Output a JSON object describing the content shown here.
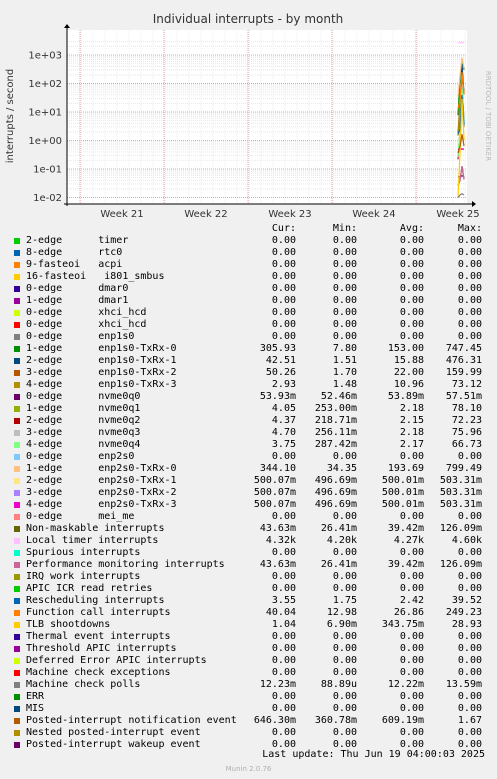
{
  "chart_data": {
    "type": "line",
    "title": "Individual interrupts - by month",
    "ylabel": "interrupts / second",
    "yscale": "log",
    "ylim": [
      0.01,
      3000
    ],
    "yticks": [
      "1e-02",
      "1e-01",
      "1e+00",
      "1e+01",
      "1e+02",
      "1e+03"
    ],
    "x_ticks": [
      "Week 21",
      "Week 22",
      "Week 23",
      "Week 24",
      "Week 25"
    ],
    "grid": true,
    "watermark": "RRDTOOL / TOBI OETIKER",
    "columns": [
      "Cur:",
      "Min:",
      "Avg:",
      "Max:"
    ],
    "series": [
      {
        "name": "2-edge      timer",
        "color": "#00cc00",
        "cur": "0.00",
        "min": "0.00",
        "avg": "0.00",
        "max": "0.00"
      },
      {
        "name": "8-edge      rtc0",
        "color": "#0066b3",
        "cur": "0.00",
        "min": "0.00",
        "avg": "0.00",
        "max": "0.00"
      },
      {
        "name": "9-fasteoi   acpi",
        "color": "#ff8000",
        "cur": "0.00",
        "min": "0.00",
        "avg": "0.00",
        "max": "0.00"
      },
      {
        "name": "16-fasteoi   i801_smbus",
        "color": "#ffcc00",
        "cur": "0.00",
        "min": "0.00",
        "avg": "0.00",
        "max": "0.00"
      },
      {
        "name": "0-edge      dmar0",
        "color": "#330099",
        "cur": "0.00",
        "min": "0.00",
        "avg": "0.00",
        "max": "0.00"
      },
      {
        "name": "1-edge      dmar1",
        "color": "#990099",
        "cur": "0.00",
        "min": "0.00",
        "avg": "0.00",
        "max": "0.00"
      },
      {
        "name": "0-edge      xhci_hcd",
        "color": "#ccff00",
        "cur": "0.00",
        "min": "0.00",
        "avg": "0.00",
        "max": "0.00"
      },
      {
        "name": "0-edge      xhci_hcd",
        "color": "#ff0000",
        "cur": "0.00",
        "min": "0.00",
        "avg": "0.00",
        "max": "0.00"
      },
      {
        "name": "0-edge      enp1s0",
        "color": "#808080",
        "cur": "0.00",
        "min": "0.00",
        "avg": "0.00",
        "max": "0.00"
      },
      {
        "name": "1-edge      enp1s0-TxRx-0",
        "color": "#008f00",
        "cur": "305.93",
        "min": "7.80",
        "avg": "153.00",
        "max": "747.45"
      },
      {
        "name": "2-edge      enp1s0-TxRx-1",
        "color": "#00487d",
        "cur": "42.51",
        "min": "1.51",
        "avg": "15.88",
        "max": "476.31"
      },
      {
        "name": "3-edge      enp1s0-TxRx-2",
        "color": "#b35a00",
        "cur": "50.26",
        "min": "1.70",
        "avg": "22.00",
        "max": "159.99"
      },
      {
        "name": "4-edge      enp1s0-TxRx-3",
        "color": "#b38f00",
        "cur": "2.93",
        "min": "1.48",
        "avg": "10.96",
        "max": "73.12"
      },
      {
        "name": "0-edge      nvme0q0",
        "color": "#6b006b",
        "cur": "53.93m",
        "min": "52.46m",
        "avg": "53.89m",
        "max": "57.51m"
      },
      {
        "name": "1-edge      nvme0q1",
        "color": "#8fb300",
        "cur": "4.05",
        "min": "253.00m",
        "avg": "2.18",
        "max": "78.10"
      },
      {
        "name": "2-edge      nvme0q2",
        "color": "#b30000",
        "cur": "4.37",
        "min": "218.71m",
        "avg": "2.15",
        "max": "72.23"
      },
      {
        "name": "3-edge      nvme0q3",
        "color": "#bebebe",
        "cur": "4.70",
        "min": "256.11m",
        "avg": "2.18",
        "max": "75.96"
      },
      {
        "name": "4-edge      nvme0q4",
        "color": "#80ff80",
        "cur": "3.75",
        "min": "287.42m",
        "avg": "2.17",
        "max": "66.73"
      },
      {
        "name": "0-edge      enp2s0",
        "color": "#80c9ff",
        "cur": "0.00",
        "min": "0.00",
        "avg": "0.00",
        "max": "0.00"
      },
      {
        "name": "1-edge      enp2s0-TxRx-0",
        "color": "#ffc080",
        "cur": "344.10",
        "min": "34.35",
        "avg": "193.69",
        "max": "799.49"
      },
      {
        "name": "2-edge      enp2s0-TxRx-1",
        "color": "#ffe680",
        "cur": "500.07m",
        "min": "496.69m",
        "avg": "500.01m",
        "max": "503.31m"
      },
      {
        "name": "3-edge      enp2s0-TxRx-2",
        "color": "#aa80ff",
        "cur": "500.07m",
        "min": "496.69m",
        "avg": "500.01m",
        "max": "503.31m"
      },
      {
        "name": "4-edge      enp2s0-TxRx-3",
        "color": "#ee00cc",
        "cur": "500.07m",
        "min": "496.69m",
        "avg": "500.01m",
        "max": "503.31m"
      },
      {
        "name": "0-edge      mei_me",
        "color": "#ff8080",
        "cur": "0.00",
        "min": "0.00",
        "avg": "0.00",
        "max": "0.00"
      },
      {
        "name": "Non-maskable interrupts",
        "color": "#666600",
        "cur": "43.63m",
        "min": "26.41m",
        "avg": "39.42m",
        "max": "126.09m"
      },
      {
        "name": "Local timer interrupts",
        "color": "#ffbfff",
        "cur": "4.32k",
        "min": "4.20k",
        "avg": "4.27k",
        "max": "4.60k"
      },
      {
        "name": "Spurious interrupts",
        "color": "#00ffcc",
        "cur": "0.00",
        "min": "0.00",
        "avg": "0.00",
        "max": "0.00"
      },
      {
        "name": "Performance monitoring interrupts",
        "color": "#cc6699",
        "cur": "43.63m",
        "min": "26.41m",
        "avg": "39.42m",
        "max": "126.09m"
      },
      {
        "name": "IRQ work interrupts",
        "color": "#999900",
        "cur": "0.00",
        "min": "0.00",
        "avg": "0.00",
        "max": "0.00"
      },
      {
        "name": "APIC ICR read retries",
        "color": "#00cc00",
        "cur": "0.00",
        "min": "0.00",
        "avg": "0.00",
        "max": "0.00"
      },
      {
        "name": "Rescheduling interrupts",
        "color": "#0066b3",
        "cur": "3.55",
        "min": "1.75",
        "avg": "2.42",
        "max": "39.52"
      },
      {
        "name": "Function call interrupts",
        "color": "#ff8000",
        "cur": "40.04",
        "min": "12.98",
        "avg": "26.86",
        "max": "249.23"
      },
      {
        "name": "TLB shootdowns",
        "color": "#ffcc00",
        "cur": "1.04",
        "min": "6.90m",
        "avg": "343.75m",
        "max": "28.93"
      },
      {
        "name": "Thermal event interrupts",
        "color": "#330099",
        "cur": "0.00",
        "min": "0.00",
        "avg": "0.00",
        "max": "0.00"
      },
      {
        "name": "Threshold APIC interrupts",
        "color": "#990099",
        "cur": "0.00",
        "min": "0.00",
        "avg": "0.00",
        "max": "0.00"
      },
      {
        "name": "Deferred Error APIC interrupts",
        "color": "#ccff00",
        "cur": "0.00",
        "min": "0.00",
        "avg": "0.00",
        "max": "0.00"
      },
      {
        "name": "Machine check exceptions",
        "color": "#ff0000",
        "cur": "0.00",
        "min": "0.00",
        "avg": "0.00",
        "max": "0.00"
      },
      {
        "name": "Machine check polls",
        "color": "#808080",
        "cur": "12.23m",
        "min": "88.89u",
        "avg": "12.22m",
        "max": "13.59m"
      },
      {
        "name": "ERR",
        "color": "#008f00",
        "cur": "0.00",
        "min": "0.00",
        "avg": "0.00",
        "max": "0.00"
      },
      {
        "name": "MIS",
        "color": "#00487d",
        "cur": "0.00",
        "min": "0.00",
        "avg": "0.00",
        "max": "0.00"
      },
      {
        "name": "Posted-interrupt notification event",
        "color": "#b35a00",
        "cur": "646.30m",
        "min": "360.78m",
        "avg": "609.19m",
        "max": "1.67"
      },
      {
        "name": "Nested posted-interrupt event",
        "color": "#b38f00",
        "cur": "0.00",
        "min": "0.00",
        "avg": "0.00",
        "max": "0.00"
      },
      {
        "name": "Posted-interrupt wakeup event",
        "color": "#6b006b",
        "cur": "0.00",
        "min": "0.00",
        "avg": "0.00",
        "max": "0.00"
      }
    ],
    "last_update": "Last update:  Thu Jun 19 04:00:03 2025",
    "footer": "Munin 2.0.76"
  }
}
